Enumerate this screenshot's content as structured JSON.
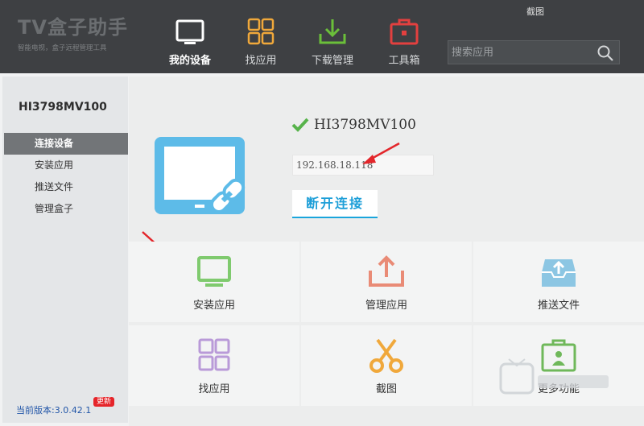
{
  "header": {
    "logo_title": "TV盒子助手",
    "logo_subtitle": "智能电视，盒子远程管理工具",
    "screenshot_label": "截图",
    "nav": [
      {
        "label": "我的设备",
        "icon": "tv-icon"
      },
      {
        "label": "找应用",
        "icon": "grid-icon"
      },
      {
        "label": "下载管理",
        "icon": "download-icon"
      },
      {
        "label": "工具箱",
        "icon": "toolbox-icon"
      }
    ],
    "search_placeholder": "搜索应用"
  },
  "sidebar": {
    "device_name": "HI3798MV100",
    "items": [
      {
        "label": "连接设备"
      },
      {
        "label": "安装应用"
      },
      {
        "label": "推送文件"
      },
      {
        "label": "管理盒子"
      }
    ],
    "version": "当前版本:3.0.42.1",
    "update_badge": "更新"
  },
  "main": {
    "device_status": "HI3798MV100",
    "ip_address": "192.168.18.118",
    "disconnect_label": "断开连接",
    "tiles": [
      {
        "label": "安装应用",
        "icon": "monitor-icon"
      },
      {
        "label": "管理应用",
        "icon": "upload-tray-icon"
      },
      {
        "label": "推送文件",
        "icon": "push-box-icon"
      },
      {
        "label": "找应用",
        "icon": "grid-icon"
      },
      {
        "label": "截图",
        "icon": "scissors-icon"
      },
      {
        "label": "更多功能",
        "icon": "more-icon"
      }
    ]
  },
  "colors": {
    "header_bg": "#3e4043",
    "accent_blue": "#1e9fd8",
    "check_green": "#57b34b",
    "arrow_red": "#e3262b"
  }
}
